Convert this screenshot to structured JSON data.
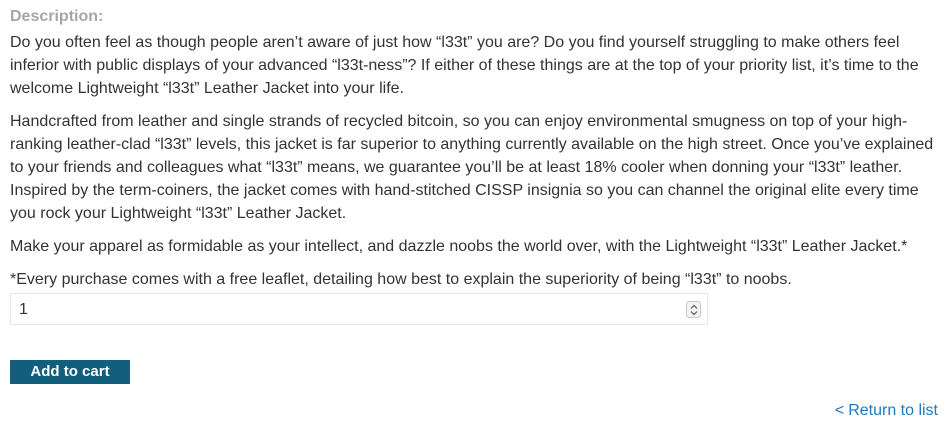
{
  "description": {
    "label": "Description:",
    "paragraphs": [
      "Do you often feel as though people aren’t aware of just how “l33t” you are? Do you find yourself struggling to make others feel inferior with public displays of your advanced “l33t-ness”? If either of these things are at the top of your priority list, it’s time to the welcome Lightweight “l33t” Leather Jacket into your life.",
      "Handcrafted from leather and single strands of recycled bitcoin, so you can enjoy environmental smugness on top of your high-ranking leather-clad “l33t” levels, this jacket is far superior to anything currently available on the high street. Once you’ve explained to your friends and colleagues what “l33t” means, we guarantee you’ll be at least 18% cooler when donning your “l33t” leather. Inspired by the term-coiners, the jacket comes with hand-stitched CISSP insignia so you can channel the original elite every time you rock your Lightweight “l33t” Leather Jacket.",
      "Make your apparel as formidable as your intellect, and dazzle noobs the world over, with the Lightweight “l33t” Leather Jacket.*",
      "*Every purchase comes with a free leaflet, detailing how best to explain the superiority of being “l33t” to noobs."
    ]
  },
  "quantity": {
    "value": "1",
    "stepper_icon": "spin-stepper-icon"
  },
  "cart": {
    "add_label": "Add to cart"
  },
  "nav": {
    "return_chevron": "<",
    "return_label": "Return to list"
  },
  "colors": {
    "button_bg": "#125f7d",
    "link": "#1a7bbd",
    "label": "#a6a6a6",
    "text": "#333332"
  }
}
